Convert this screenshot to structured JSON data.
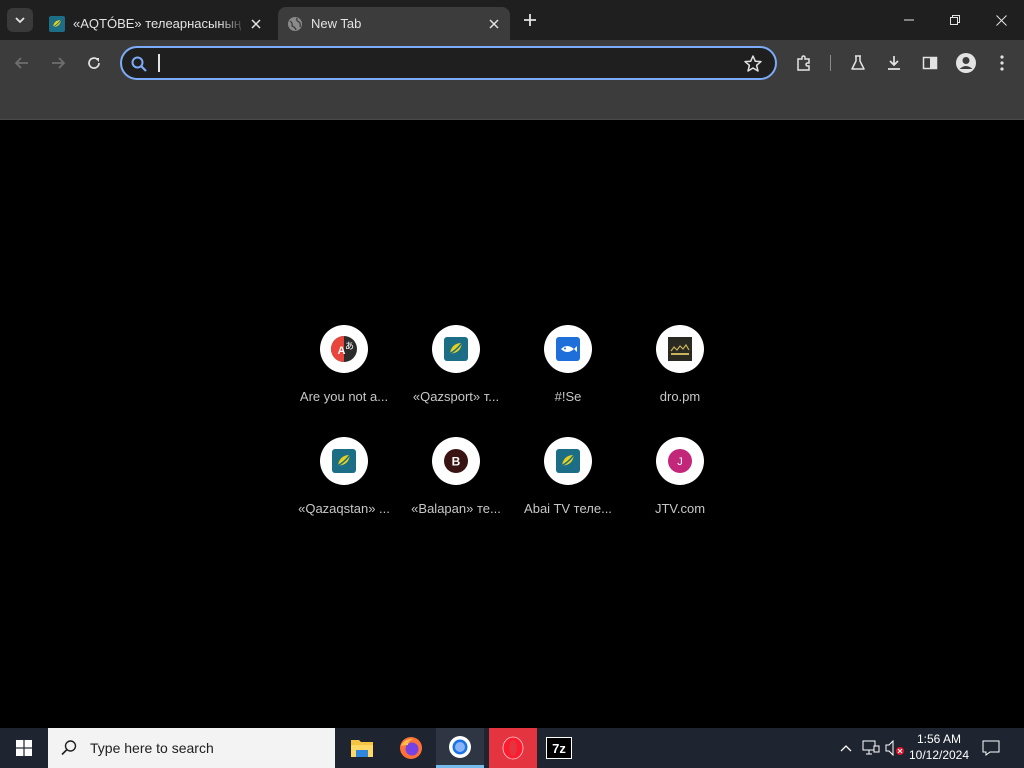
{
  "tabs": [
    {
      "title": "«AQTÓBE» телеарнасының р",
      "active": false
    },
    {
      "title": "New Tab",
      "active": true
    }
  ],
  "omnibox": {
    "value": "",
    "placeholder": ""
  },
  "shortcuts": [
    {
      "label": "Are you not a...",
      "icon": "translate-icon",
      "glyph": "A"
    },
    {
      "label": "«Qazsport» т...",
      "icon": "qaz-logo-icon",
      "glyph": ""
    },
    {
      "label": "#!Se",
      "icon": "fish-icon",
      "glyph": ""
    },
    {
      "label": "dro.pm",
      "icon": "dro-icon",
      "glyph": ""
    },
    {
      "label": "«Qazaqstan» ...",
      "icon": "qaz-logo-icon",
      "glyph": ""
    },
    {
      "label": "«Balapan» те...",
      "icon": "letter-b-icon",
      "glyph": "B"
    },
    {
      "label": "Abai TV теле...",
      "icon": "qaz-logo-icon",
      "glyph": ""
    },
    {
      "label": "JTV.com",
      "icon": "letter-j-icon",
      "glyph": "J"
    }
  ],
  "taskbar": {
    "search_label": "Type here to search",
    "apps": [
      "file-explorer-icon",
      "firefox-icon",
      "chrome-icon",
      "opera-icon",
      "7zip-icon"
    ],
    "app_7z_text": "7z"
  },
  "clock": {
    "time": "1:56 AM",
    "date": "10/12/2024"
  },
  "colors": {
    "accent": "#7cacf8",
    "background": "#000000",
    "toolbar": "#3c3c3c"
  }
}
